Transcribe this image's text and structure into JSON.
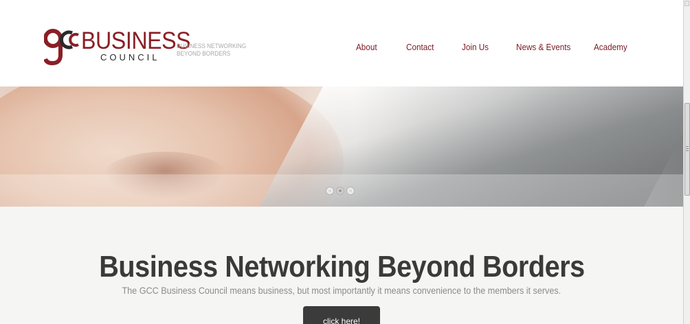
{
  "brand": {
    "logo_mark_text": "GCC",
    "name_line1": "BUSINESS",
    "name_line2": "COUNCIL",
    "tagline": "BUSINESS NETWORKING BEYOND BORDERS",
    "colors": {
      "brand_red": "#8a1f26",
      "brand_dark": "#2a2a2a"
    }
  },
  "nav": {
    "items": [
      {
        "label": "About"
      },
      {
        "label": "Contact"
      },
      {
        "label": "Join Us"
      },
      {
        "label": "News & Events"
      },
      {
        "label": "Academy"
      }
    ]
  },
  "hero": {
    "slide_count": 3,
    "active_slide": 2
  },
  "main": {
    "title": "Business Networking Beyond Borders",
    "subtitle": "The GCC Business Council means business, but most importantly it means convenience to the members it serves.",
    "cta_label": "click here!"
  },
  "colors": {
    "nav_text": "#7a1a22",
    "title_text": "#3a3a3a",
    "cta_background": "#3b3b3b",
    "page_background": "#f5f5f4"
  }
}
